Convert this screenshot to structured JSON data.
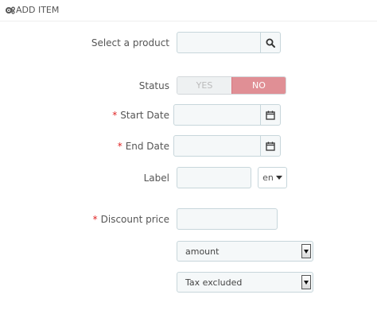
{
  "header": {
    "title": "ADD ITEM",
    "icon": "gears-icon"
  },
  "form": {
    "product": {
      "label": "Select a product",
      "value": "",
      "placeholder": "",
      "button_icon": "search-icon"
    },
    "status": {
      "label": "Status",
      "yes_label": "YES",
      "no_label": "NO",
      "selected": "NO",
      "active_color": "#e08f95"
    },
    "start_date": {
      "required_mark": "*",
      "label": "Start Date",
      "value": "",
      "button_icon": "calendar-icon"
    },
    "end_date": {
      "required_mark": "*",
      "label": "End Date",
      "value": "",
      "button_icon": "calendar-icon"
    },
    "item_label": {
      "label": "Label",
      "value": "",
      "language": "en"
    },
    "discount": {
      "required_mark": "*",
      "label": "Discount price",
      "value": "",
      "type_selected": "amount",
      "tax_selected": "Tax excluded"
    }
  }
}
